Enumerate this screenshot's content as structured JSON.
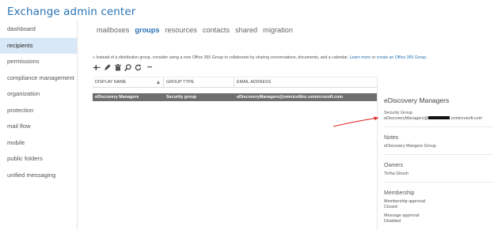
{
  "app": {
    "title": "Exchange admin center"
  },
  "sidebar": {
    "items": [
      {
        "label": "dashboard",
        "active": false
      },
      {
        "label": "recipients",
        "active": true
      },
      {
        "label": "permissions",
        "active": false
      },
      {
        "label": "compliance management",
        "active": false
      },
      {
        "label": "organization",
        "active": false
      },
      {
        "label": "protection",
        "active": false
      },
      {
        "label": "mail flow",
        "active": false
      },
      {
        "label": "mobile",
        "active": false
      },
      {
        "label": "public folders",
        "active": false
      },
      {
        "label": "unified messaging",
        "active": false
      }
    ]
  },
  "tabs": [
    {
      "label": "mailboxes",
      "active": false
    },
    {
      "label": "groups",
      "active": true
    },
    {
      "label": "resources",
      "active": false
    },
    {
      "label": "contacts",
      "active": false
    },
    {
      "label": "shared",
      "active": false
    },
    {
      "label": "migration",
      "active": false
    }
  ],
  "hint": {
    "prefix": "» Instead of a distribution group, consider using a new Office 365 Group to collaborate by sharing conversations, documents, and a calendar.",
    "learn_more": "Learn more",
    "or": "or",
    "create_link": "create an Office 365 Group",
    "suffix": "."
  },
  "toolbar": {
    "icons": [
      "add-icon",
      "edit-icon",
      "delete-icon",
      "search-icon",
      "refresh-icon",
      "more-icon"
    ],
    "more_label": "•••"
  },
  "grid": {
    "headers": {
      "name": "DISPLAY NAME",
      "type": "GROUP TYPE",
      "email": "EMAIL ADDRESS"
    },
    "rows": [
      {
        "name": "eDiscovery Managers",
        "type": "Security group",
        "email": "eDiscoveryManagers@omnicellinc.onmicrosoft.com"
      }
    ]
  },
  "details": {
    "title": "eDiscovery Managers",
    "group_type": "Security Group",
    "email_prefix": "eDiscoveryManagers@",
    "email_suffix": ".onmicrosoft.com",
    "notes_header": "Notes",
    "notes_value": "eDiscovery Mangers Group",
    "owners_header": "Owners",
    "owners_value": "Tirtha Ghosh",
    "membership_header": "Membership",
    "membership_approval_label": "Membership approval:",
    "membership_approval_value": "Closed",
    "message_approval_label": "Message approval:",
    "message_approval_value": "Disabled"
  },
  "colors": {
    "accent": "#2a73b4",
    "selected_row": "#6f6f6f",
    "annotation": "#e02020"
  }
}
